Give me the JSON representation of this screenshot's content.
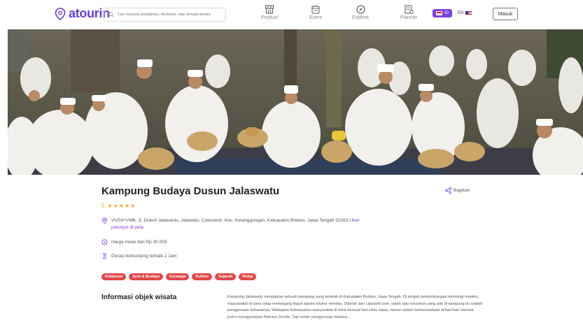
{
  "header": {
    "logo_text": "atourin",
    "search_placeholder": "Cari rencana perjalanan, destinasi, atau tempat wisata",
    "nav": [
      {
        "label": "Product",
        "icon": "store-icon"
      },
      {
        "label": "Event",
        "icon": "calendar-icon"
      },
      {
        "label": "Explore",
        "icon": "compass-icon"
      },
      {
        "label": "Planner",
        "icon": "planner-icon"
      }
    ],
    "lang_id": "ID",
    "lang_en": "EN",
    "login_label": "Masuk"
  },
  "colors": {
    "brand": "#6a3fc4",
    "accent": "#7b3fe0",
    "tag": "#e04848",
    "star": "#f5a623"
  },
  "place": {
    "title": "Kampung Budaya Dusun Jalaswatu",
    "share_label": "Bagikan",
    "rating": "5",
    "stars": "★★★★★",
    "address": "VVG9+VM6, Jl. Dukuh Jalawastu, Jalawatu, Ciseureuh, Kec. Ketanggungan, Kabupaten Brebes, Jawa Tengah 52263",
    "map_link_a": "Lihat",
    "map_link_b": "petunjuk di peta",
    "price": "Harga mulai dari Rp 30.000",
    "duration": "Durasi berkunjung terbaik 2 Jam",
    "tags": [
      "Relaksasi",
      "Seni & Budaya",
      "Keluarga",
      "Kuliner",
      "Sejarah",
      "Religi"
    ]
  },
  "info": {
    "heading": "Informasi objek wisata",
    "paragraph": "Kampung Jalawastu merupakan sebuah kampung yang terletak di Kabupaten Brebes, Jawa Tengah. Di tengah perkembangan teknologi modern, masyarakat di sana tetap memegang teguh ajaran leluhur mereka. Dilansir dari Liputan6.com, salah satu keunikan yang ada di kampung itu adalah penggunaan bahasanya. Walaupun kebanyakan masyarakat di sana berasal dari etnis Jawa, namun dalam berkomunikasi sehari-hari mereka justru menggunakan Bahasa Sunda. Tapi selain penggunaan bahasa..."
  }
}
